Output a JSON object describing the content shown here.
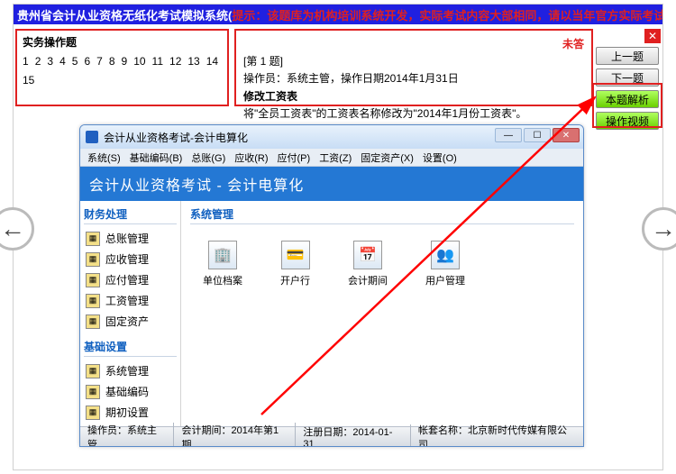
{
  "system_bar": {
    "white": "贵州省会计从业资格无纸化考试模拟系统(",
    "red1": "提示：该题库为机构培训系统开发，实际考试内容大部相同，请以当年官方实际考试内容为准",
    "white2": ")"
  },
  "header": {
    "left_title": "实务操作题",
    "question_numbers": [
      "1",
      "2",
      "3",
      "4",
      "5",
      "6",
      "7",
      "8",
      "9",
      "10",
      "11",
      "12",
      "13",
      "14",
      "15"
    ],
    "status": "未答",
    "q_tag": "[第 1 题]",
    "q_line1": "操作员：系统主管，操作日期2014年1月31日",
    "q_bold": "修改工资表",
    "q_line2": "将\"全员工资表\"的工资表名称修改为\"2014年1月份工资表\"。"
  },
  "buttons": {
    "prev": "上一题",
    "next": "下一题",
    "analysis": "本题解析",
    "video": "操作视频"
  },
  "window": {
    "title": "会计从业资格考试-会计电算化",
    "menu": [
      "系统(S)",
      "基础编码(B)",
      "总账(G)",
      "应收(R)",
      "应付(P)",
      "工资(Z)",
      "固定资产(X)",
      "设置(O)"
    ],
    "blue_title": "会计从业资格考试 - 会计电算化",
    "side_h1": "财务处理",
    "side1": [
      "总账管理",
      "应收管理",
      "应付管理",
      "工资管理",
      "固定资产"
    ],
    "side_h2": "基础设置",
    "side2": [
      "系统管理",
      "基础编码",
      "期初设置"
    ],
    "main_h": "系统管理",
    "apps": [
      {
        "label": "单位档案",
        "glyph": "🏢"
      },
      {
        "label": "开户行",
        "glyph": "💳"
      },
      {
        "label": "会计期间",
        "glyph": "📅"
      },
      {
        "label": "用户管理",
        "glyph": "👥"
      }
    ],
    "status": {
      "s1l": "操作员：",
      "s1v": "系统主管",
      "s2l": "会计期间：",
      "s2v": "2014年第1期",
      "s3l": "注册日期：",
      "s3v": "2014-01-31",
      "s4l": "帐套名称：",
      "s4v": "北京新时代传媒有限公司"
    }
  }
}
